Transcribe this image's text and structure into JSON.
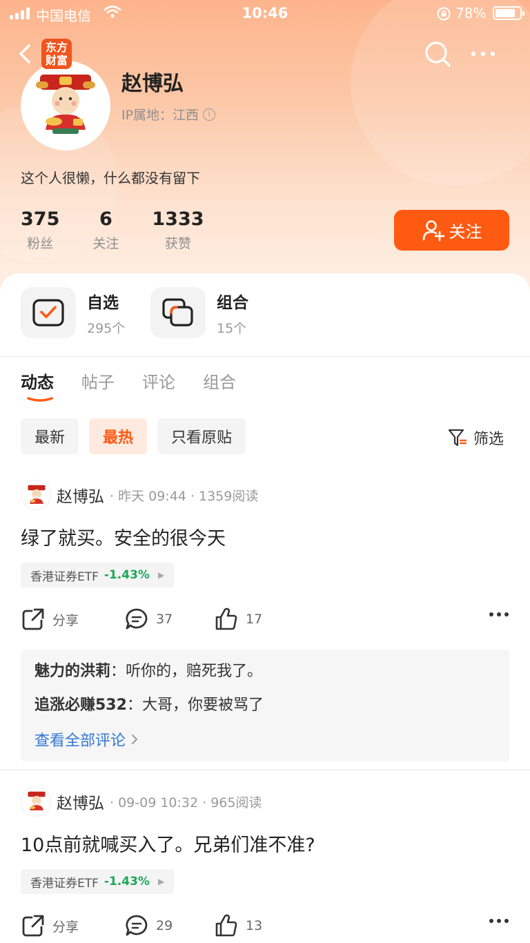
{
  "status_bar": {
    "carrier": "中国电信",
    "time": "10:46",
    "battery": "78%"
  },
  "header": {
    "app_badge_line1": "东方",
    "app_badge_line2": "财富"
  },
  "profile": {
    "name": "赵博弘",
    "ip_location": "IP属地：江西",
    "bio": "这个人很懒，什么都没有留下",
    "stats": [
      {
        "value": "375",
        "label": "粉丝"
      },
      {
        "value": "6",
        "label": "关注"
      },
      {
        "value": "1333",
        "label": "获赞"
      }
    ],
    "follow_label": "关注"
  },
  "quick_links": [
    {
      "title": "自选",
      "count": "295个"
    },
    {
      "title": "组合",
      "count": "15个"
    }
  ],
  "tabs": [
    {
      "label": "动态",
      "active": true
    },
    {
      "label": "帖子",
      "active": false
    },
    {
      "label": "评论",
      "active": false
    },
    {
      "label": "组合",
      "active": false
    }
  ],
  "filters": {
    "chips": [
      {
        "label": "最新",
        "active": false
      },
      {
        "label": "最热",
        "active": true
      },
      {
        "label": "只看原贴",
        "active": false
      }
    ],
    "filter_label": "筛选"
  },
  "posts": [
    {
      "author": "赵博弘",
      "meta": "· 昨天 09:44 · 1359阅读",
      "content": "绿了就买。安全的很今天",
      "stock_name": "香港证券ETF",
      "stock_change": "-1.43%",
      "share_label": "分享",
      "comment_count": "37",
      "like_count": "17",
      "comments": [
        {
          "user": "魅力的洪莉",
          "text": "听你的，赔死我了。"
        },
        {
          "user": "追涨必赚532",
          "text": "大哥，你要被骂了"
        }
      ],
      "view_all": "查看全部评论"
    },
    {
      "author": "赵博弘",
      "meta": "· 09-09 10:32 · 965阅读",
      "content": "10点前就喊买入了。兄弟们准不准?",
      "stock_name": "香港证券ETF",
      "stock_change": "-1.43%",
      "share_label": "分享",
      "comment_count": "29",
      "like_count": "13"
    }
  ],
  "colors": {
    "accent": "#ff5a12",
    "down_green": "#1ea65a",
    "link_blue": "#3477d4"
  }
}
